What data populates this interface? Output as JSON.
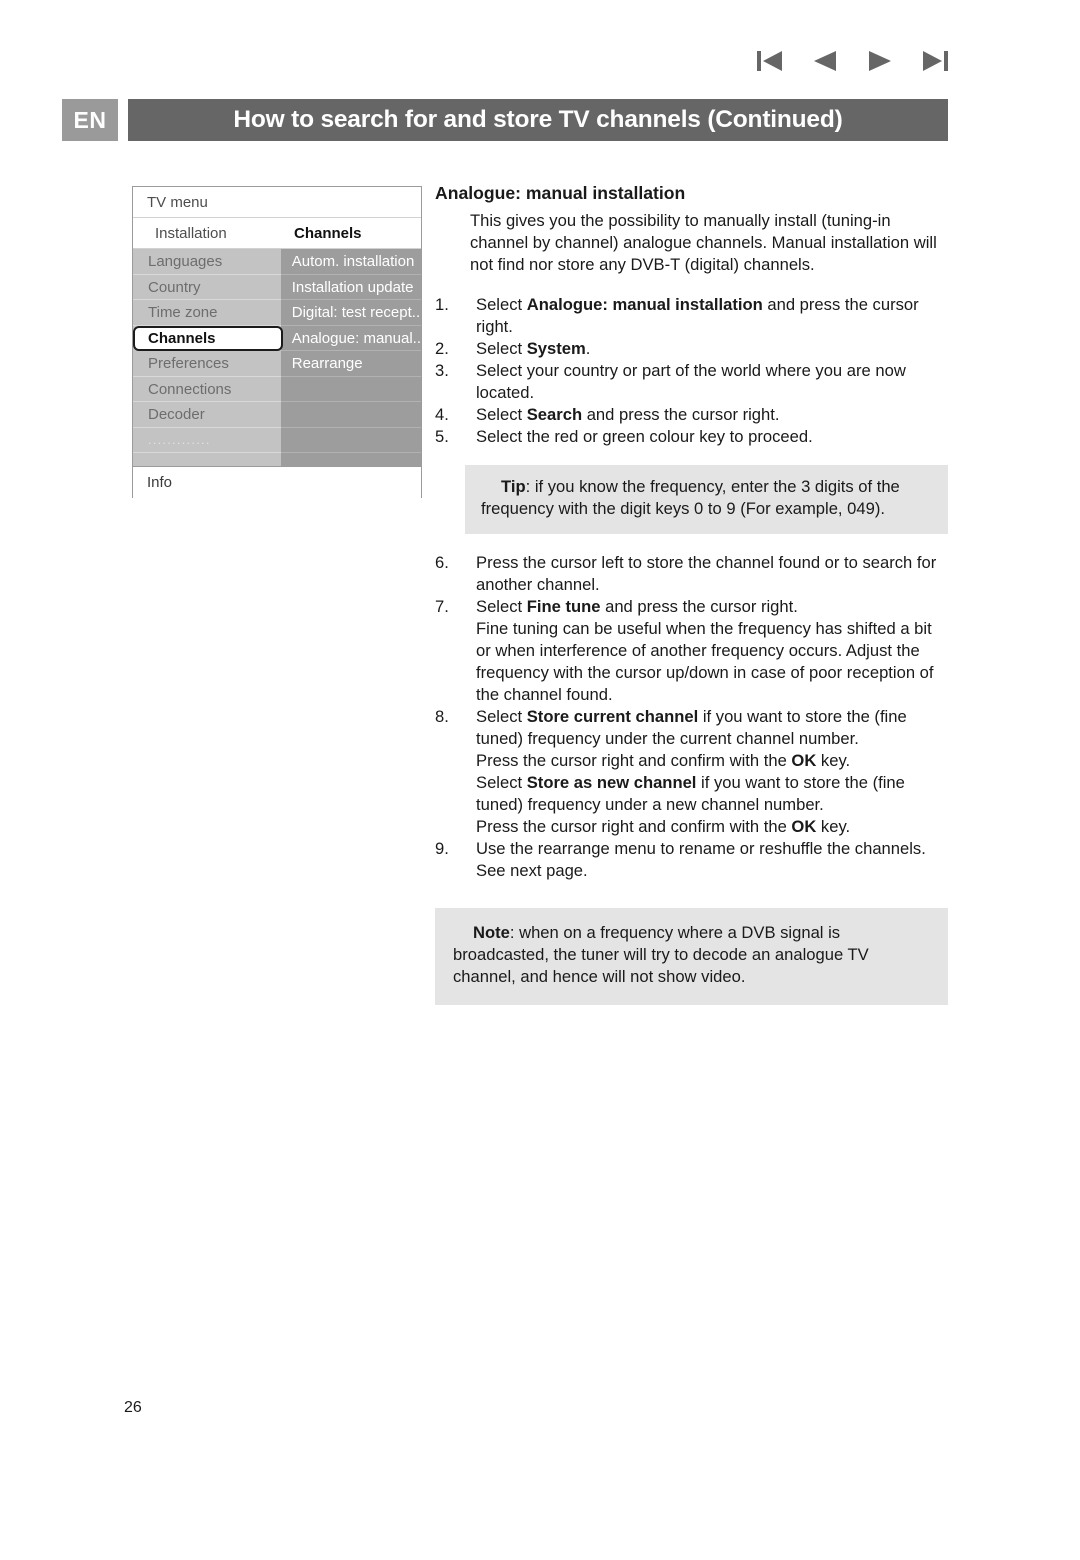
{
  "nav": {
    "icons": [
      {
        "name": "skip-to-first-icon",
        "label": "First page"
      },
      {
        "name": "previous-page-icon",
        "label": "Previous page"
      },
      {
        "name": "next-page-icon",
        "label": "Next page"
      },
      {
        "name": "skip-to-last-icon",
        "label": "Last page"
      }
    ],
    "color": "#666666"
  },
  "header": {
    "language_badge": "EN",
    "title": "How to search for and store TV channels  (Continued)",
    "bar_color": "#666666",
    "badge_color": "#9a9a9a"
  },
  "tv_menu": {
    "title": "TV menu",
    "breadcrumb_left": "Installation",
    "breadcrumb_right": "Channels",
    "left_items": [
      "Languages",
      "Country",
      "Time zone",
      "Channels",
      "Preferences",
      "Connections",
      "Decoder",
      "............."
    ],
    "selected_left_item": "Channels",
    "right_items": [
      "Autom. installation",
      "Installation update",
      "Digital: test recept..",
      "Analogue: manual..",
      "Rearrange"
    ],
    "info_label": "Info"
  },
  "content": {
    "section_title": "Analogue: manual installation",
    "intro": "This gives you the possibility to manually install (tuning-in channel by channel) analogue channels. Manual installation will not find nor store any DVB-T (digital) channels.",
    "steps_part1": [
      {
        "num": "1.",
        "pre": "Select ",
        "bold": "Analogue: manual installation",
        "post": " and press the cursor right."
      },
      {
        "num": "2.",
        "pre": "Select ",
        "bold": "System",
        "post": "."
      },
      {
        "num": "3.",
        "pre": "Select your country or part of the world where you are now located.",
        "bold": "",
        "post": ""
      },
      {
        "num": "4.",
        "pre": "Select ",
        "bold": "Search",
        "post": " and press the cursor right."
      },
      {
        "num": "5.",
        "pre": "Select the red or green colour key to proceed.",
        "bold": "",
        "post": ""
      }
    ],
    "tip": {
      "label": "Tip",
      "text": ": if you know the frequency, enter the 3 digits of the frequency with the digit keys 0 to 9 (For example, 049)."
    },
    "step6": {
      "num": "6.",
      "text": "Press the cursor left to store the channel found or to search for another channel."
    },
    "step7": {
      "num": "7.",
      "pre": "Select ",
      "bold": "Fine tune",
      "post": " and press the cursor right.",
      "detail": "Fine tuning can be useful when the frequency has shifted a bit or when interference of another frequency occurs. Adjust the frequency with the cursor up/down in case of poor reception of the channel found."
    },
    "step8": {
      "num": "8.",
      "line1_pre": "Select ",
      "line1_bold": "Store current channel",
      "line1_post": " if you want to store the (fine tuned) frequency under the current channel number.",
      "line2_pre": "Press the cursor right and confirm with the ",
      "line2_bold": "OK",
      "line2_post": " key.",
      "line3_pre": "Select ",
      "line3_bold": "Store as new channel",
      "line3_post": " if you want to store the (fine tuned) frequency under a new channel number.",
      "line4_pre": "Press the cursor right and confirm with the ",
      "line4_bold": "OK",
      "line4_post": " key."
    },
    "step9": {
      "num": "9.",
      "text": "Use the rearrange menu to rename or reshuffle the channels. See next page."
    },
    "note": {
      "label": "Note",
      "text": ": when on a frequency where a DVB signal is broadcasted, the tuner will try to decode an analogue TV channel, and hence will not show video."
    }
  },
  "page_number": "26"
}
